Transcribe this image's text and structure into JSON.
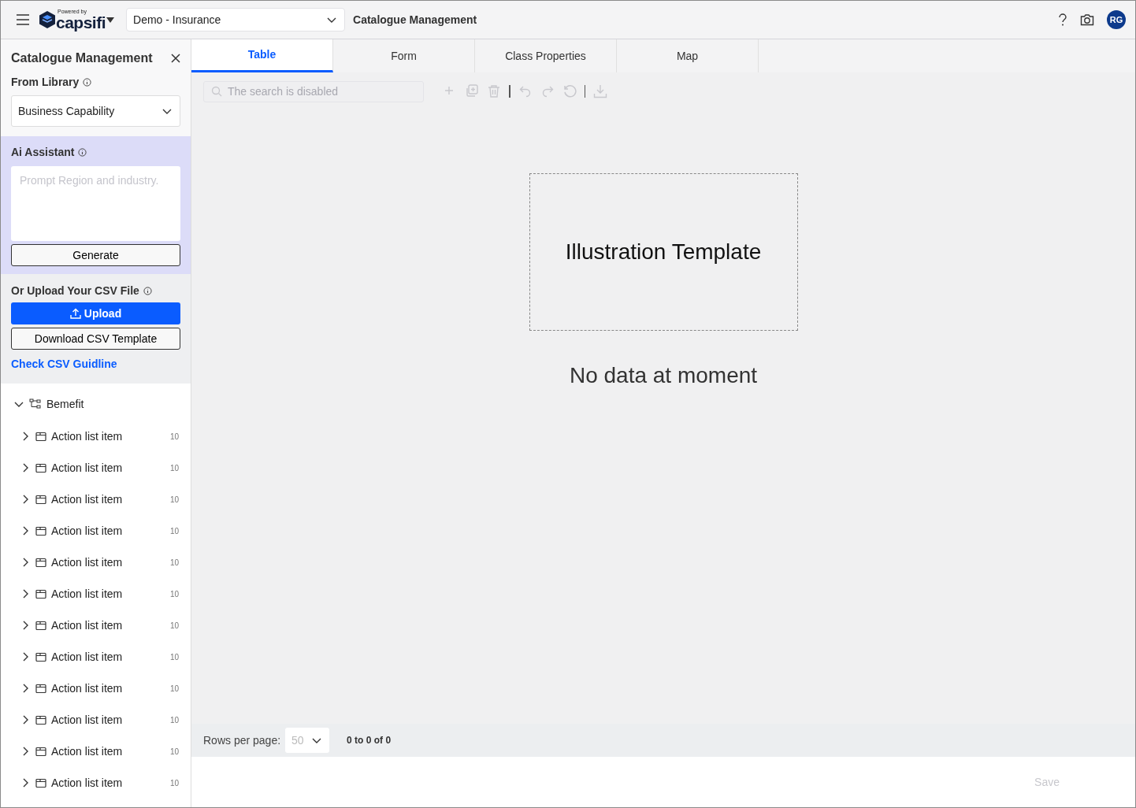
{
  "header": {
    "brand_tagline": "Powered by",
    "brand": "capsifi",
    "workspace": "Demo - Insurance",
    "page_title": "Catalogue Management",
    "avatar": "RG"
  },
  "sidebar": {
    "title": "Catalogue Management",
    "library": {
      "label": "From Library",
      "value": "Business Capability"
    },
    "ai": {
      "label": "Ai Assistant",
      "placeholder": "Prompt Region and industry.",
      "button": "Generate"
    },
    "upload": {
      "label": "Or Upload Your CSV File",
      "upload_button": "Upload",
      "template_button": "Download CSV Template",
      "guideline_link": "Check CSV Guidline"
    },
    "tree": {
      "label": "Bemefit",
      "expanded": true,
      "children": [
        {
          "label": "Action list item",
          "count": "10",
          "expanded": false
        },
        {
          "label": "Action list item",
          "count": "10",
          "expanded": false
        },
        {
          "label": "Action list item",
          "count": "10",
          "expanded": false
        },
        {
          "label": "Action list item",
          "count": "10",
          "expanded": false
        },
        {
          "label": "Action list item",
          "count": "10",
          "expanded": false
        },
        {
          "label": "Action list item",
          "count": "10",
          "expanded": false
        },
        {
          "label": "Action list item",
          "count": "10",
          "expanded": false
        },
        {
          "label": "Action list item",
          "count": "10",
          "expanded": false
        },
        {
          "label": "Action list item",
          "count": "10",
          "expanded": false
        },
        {
          "label": "Action list item",
          "count": "10",
          "expanded": false
        },
        {
          "label": "Action list item",
          "count": "10",
          "expanded": false
        },
        {
          "label": "Action list item",
          "count": "10",
          "expanded": false
        }
      ]
    }
  },
  "tabs": [
    {
      "label": "Table",
      "selected": true
    },
    {
      "label": "Form",
      "selected": false
    },
    {
      "label": "Class Properties",
      "selected": false
    },
    {
      "label": "Map",
      "selected": false
    }
  ],
  "search": {
    "placeholder": "The search is disabled",
    "disabled": true
  },
  "empty_state": {
    "illustration": "Illustration Template",
    "message": "No data at moment"
  },
  "pager": {
    "label": "Rows per page:",
    "page_size": "50",
    "range": "0 to 0 of 0"
  },
  "save": {
    "label": "Save",
    "disabled": true
  }
}
